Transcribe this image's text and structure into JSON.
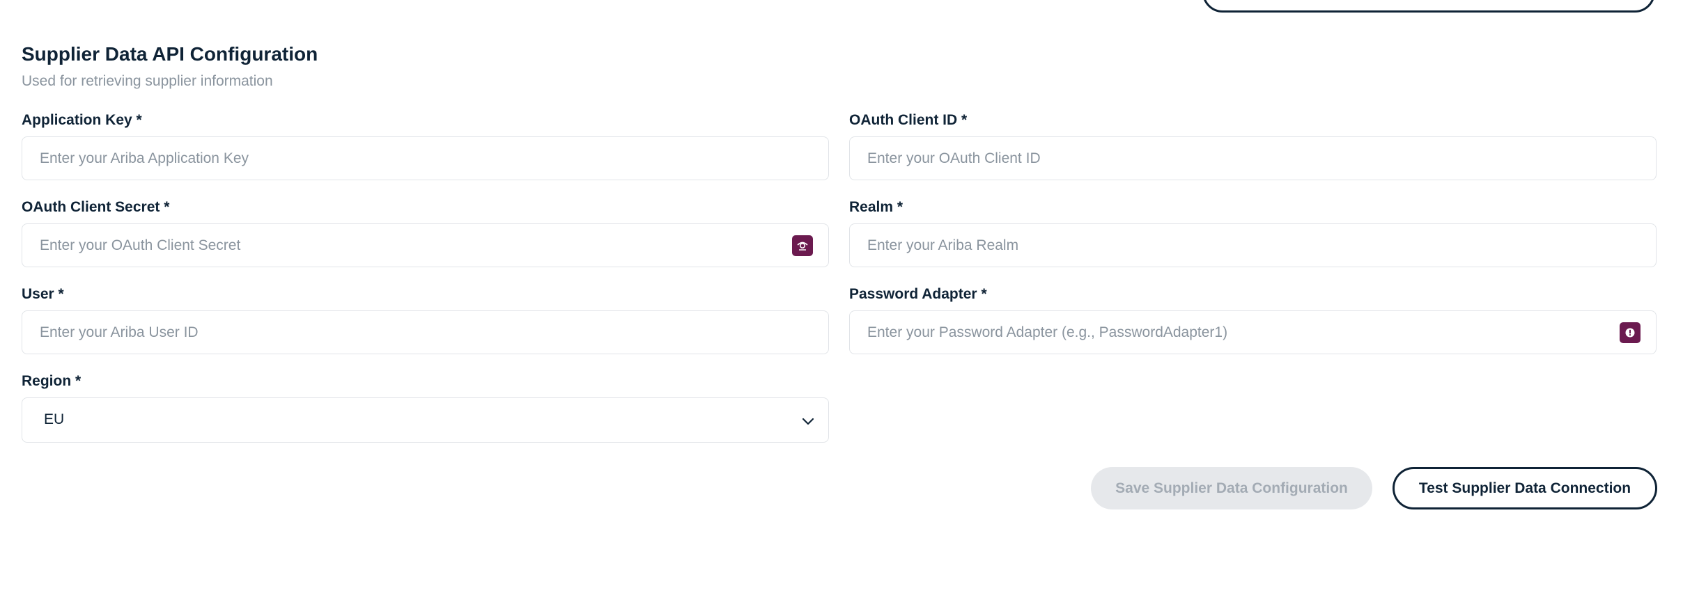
{
  "section": {
    "title": "Supplier Data API Configuration",
    "subtitle": "Used for retrieving supplier information"
  },
  "fields": {
    "application_key": {
      "label": "Application Key *",
      "placeholder": "Enter your Ariba Application Key",
      "value": ""
    },
    "oauth_client_id": {
      "label": "OAuth Client ID *",
      "placeholder": "Enter your OAuth Client ID",
      "value": ""
    },
    "oauth_client_secret": {
      "label": "OAuth Client Secret *",
      "placeholder": "Enter your OAuth Client Secret",
      "value": ""
    },
    "realm": {
      "label": "Realm *",
      "placeholder": "Enter your Ariba Realm",
      "value": ""
    },
    "user": {
      "label": "User *",
      "placeholder": "Enter your Ariba User ID",
      "value": ""
    },
    "password_adapter": {
      "label": "Password Adapter *",
      "placeholder": "Enter your Password Adapter (e.g., PasswordAdapter1)",
      "value": ""
    },
    "region": {
      "label": "Region *",
      "selected": "EU"
    }
  },
  "buttons": {
    "save": "Save Supplier Data Configuration",
    "test": "Test Supplier Data Connection"
  },
  "icons": {
    "secret_toggle": "eye-icon",
    "password_adapter_toggle": "info-icon",
    "region_dropdown": "chevron-down-icon"
  },
  "colors": {
    "text_primary": "#0f2336",
    "text_muted": "#8a949e",
    "accent": "#6b1a4f",
    "disabled_bg": "#e6e8eb",
    "input_border": "#e1e4e8"
  }
}
